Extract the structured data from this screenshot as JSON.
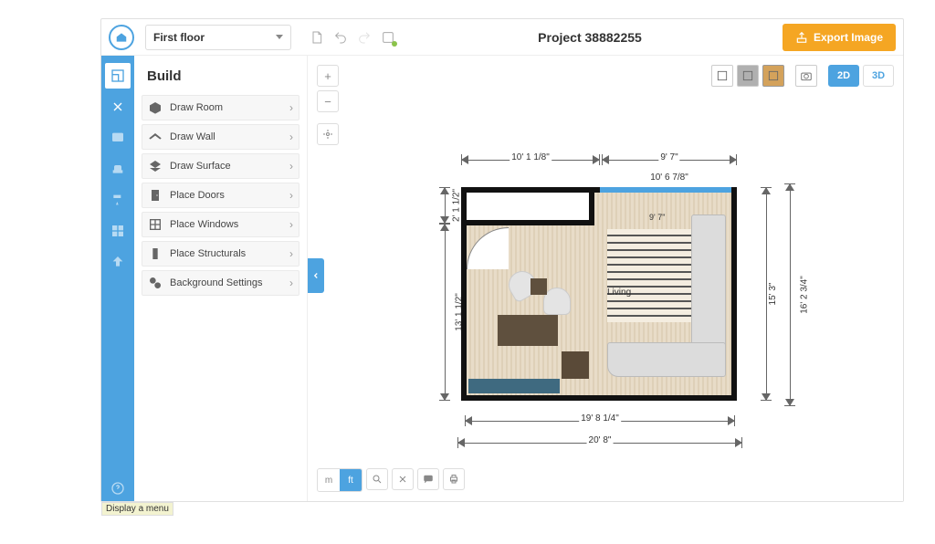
{
  "header": {
    "floor_selector": "First floor",
    "project_title": "Project 38882255",
    "export_label": "Export Image"
  },
  "panel": {
    "title": "Build",
    "tools": [
      {
        "label": "Draw Room",
        "icon": "cube"
      },
      {
        "label": "Draw Wall",
        "icon": "wall"
      },
      {
        "label": "Draw Surface",
        "icon": "surface"
      },
      {
        "label": "Place Doors",
        "icon": "door"
      },
      {
        "label": "Place Windows",
        "icon": "window"
      },
      {
        "label": "Place Structurals",
        "icon": "column"
      },
      {
        "label": "Background Settings",
        "icon": "layers"
      }
    ]
  },
  "rail": {
    "icons": [
      "floorplan",
      "tools",
      "info",
      "furnish",
      "paint",
      "materials",
      "share",
      "help"
    ]
  },
  "view_modes": {
    "d2": "2D",
    "d3": "3D"
  },
  "units": {
    "m": "m",
    "ft": "ft",
    "active": "ft"
  },
  "dimensions": {
    "top_left": "10' 1 1/8\"",
    "top_right": "9' 7\"",
    "win_1": "10' 6 7/8\"",
    "win_2": "9' 7\"",
    "left_top": "2' 1 1/2\"",
    "left_main": "13' 1 1/2\"",
    "right_a": "15' 3\"",
    "right_b": "16' 2 3/4\"",
    "bottom_a": "19' 8 1/4\"",
    "bottom_b": "20' 8\""
  },
  "room": {
    "label": "Living"
  },
  "status_tip": "Display a menu"
}
